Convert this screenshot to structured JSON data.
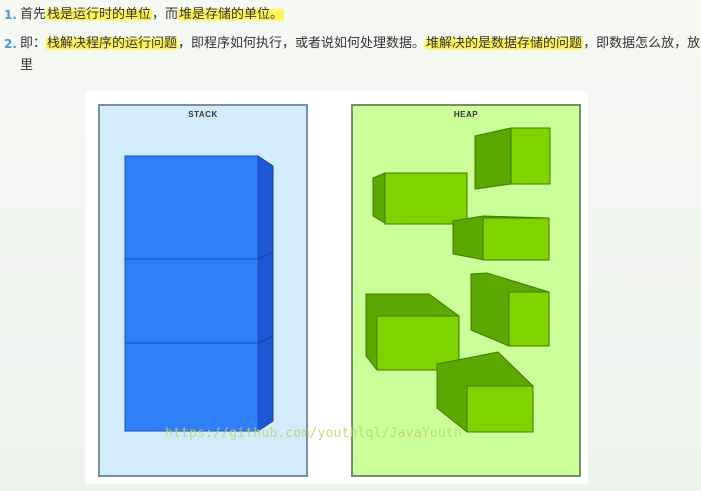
{
  "items": [
    {
      "number": "1.",
      "parts": [
        {
          "text": "首先",
          "highlight": false
        },
        {
          "text": "栈是运行时的单位",
          "highlight": true
        },
        {
          "text": "，而",
          "highlight": false
        },
        {
          "text": "堆是存储的单位。",
          "highlight": true
        }
      ]
    },
    {
      "number": "2.",
      "line1": [
        {
          "text": "即：",
          "highlight": false
        },
        {
          "text": "栈解决程序的运行问题",
          "highlight": true
        },
        {
          "text": "，即程序如何执行，或者说如何处理数据。",
          "highlight": false
        },
        {
          "text": "堆解决的是数据存储的问题",
          "highlight": true
        },
        {
          "text": "，即数据怎么放，放哪",
          "highlight": false
        }
      ],
      "line2": "里"
    }
  ],
  "figure": {
    "stack_title": "STACK",
    "heap_title": "HEAP",
    "watermark": "https://github.com/youthlql/JavaYouth",
    "colors": {
      "stack_bg": "#d3ecfb",
      "heap_bg": "#ccff99",
      "stack_block": "#2f7ff7",
      "heap_block": "#7fd400",
      "highlight": "#fff34a",
      "list_number": "#4a9ad8"
    }
  }
}
